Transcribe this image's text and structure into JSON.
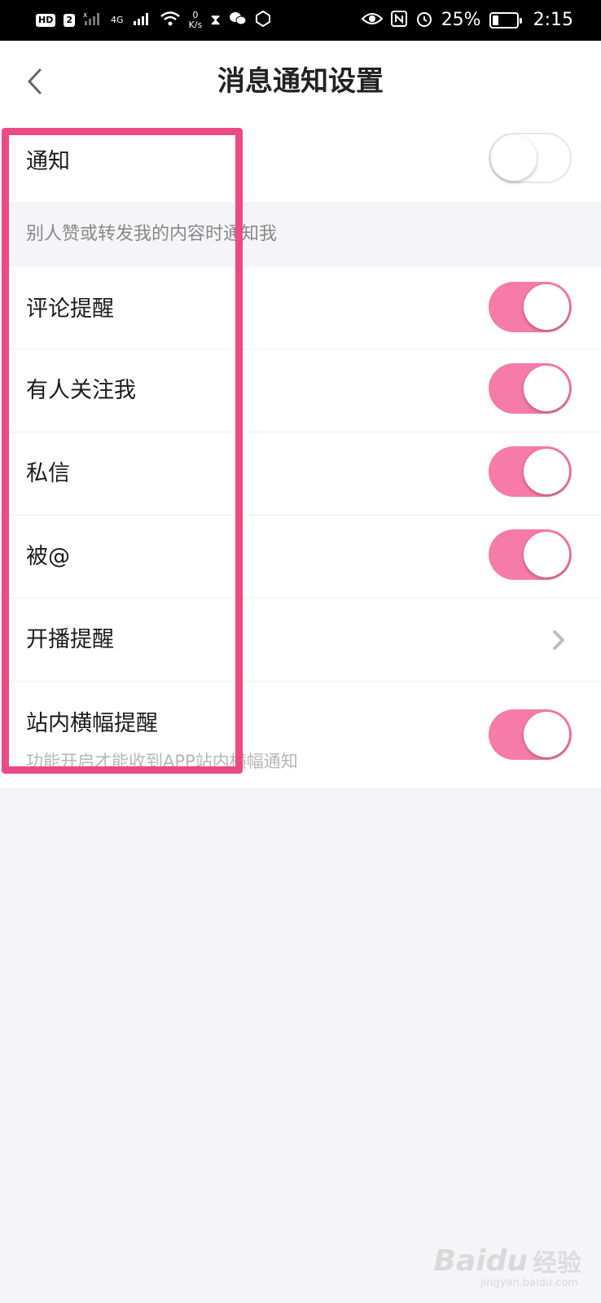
{
  "status_bar": {
    "hd_badge": "HD",
    "sim_badge": "2",
    "network_type": "4G",
    "speed_value": "0",
    "speed_unit": "K/s",
    "battery_percent": "25%",
    "battery_level": 0.25,
    "time": "2:15"
  },
  "header": {
    "title": "消息通知设置"
  },
  "settings": {
    "notify": {
      "label": "通知",
      "enabled": false
    },
    "section_header": "别人赞或转发我的内容时通知我",
    "comment": {
      "label": "评论提醒",
      "enabled": true
    },
    "follow": {
      "label": "有人关注我",
      "enabled": true
    },
    "message": {
      "label": "私信",
      "enabled": true
    },
    "mention": {
      "label": "被@",
      "enabled": true
    },
    "live": {
      "label": "开播提醒"
    },
    "banner": {
      "label": "站内横幅提醒",
      "sublabel": "功能开启才能收到APP站内横幅通知",
      "enabled": true
    }
  },
  "colors": {
    "toggle_on": "#f77ba7",
    "highlight": "#ec4a82"
  },
  "watermark": {
    "brand": "Baidu",
    "cn": "经验",
    "url": "jingyan.baidu.com"
  }
}
